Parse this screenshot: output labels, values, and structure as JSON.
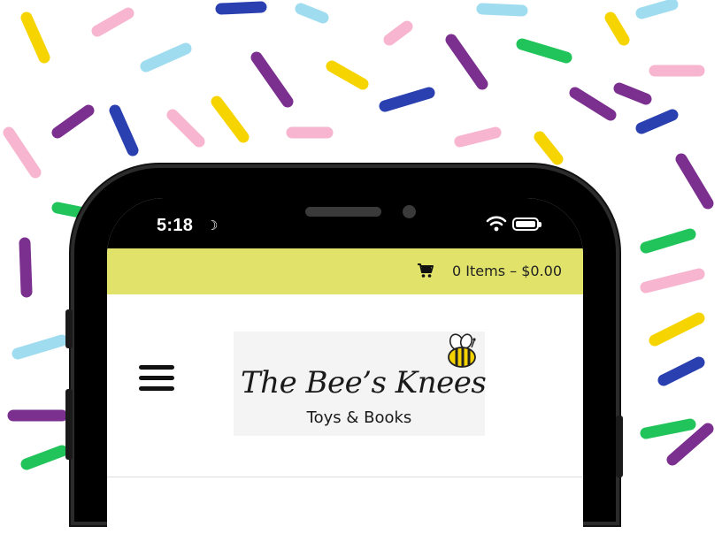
{
  "status_bar": {
    "time": "5:18",
    "icons": [
      "moon-icon",
      "wifi-icon",
      "battery-icon"
    ]
  },
  "top_bar": {
    "cart_icon": "shopping-cart-icon",
    "cart_label": "0 Items – $0.00",
    "background": "#e0e26a"
  },
  "header": {
    "menu_icon": "hamburger-menu-icon",
    "logo": {
      "title": "The Bee’s Knees",
      "subtitle": "Toys & Books",
      "mascot_icon": "bee-icon"
    }
  },
  "background": {
    "pattern": "sprinkles",
    "colors": [
      "#f6d400",
      "#f7b5cf",
      "#9fdcef",
      "#7b2f8f",
      "#2a3fb0",
      "#21c45a"
    ]
  }
}
